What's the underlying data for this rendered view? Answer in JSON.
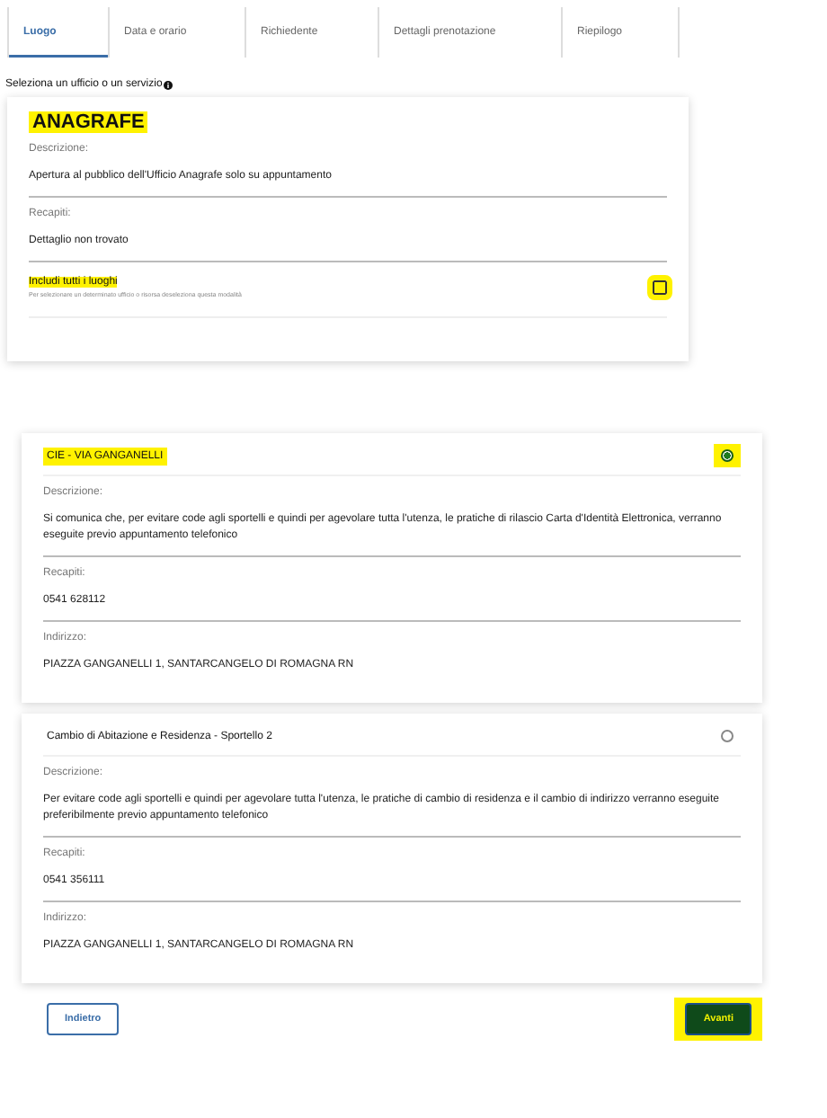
{
  "tabs": [
    {
      "label": "Luogo",
      "selected": true
    },
    {
      "label": "Data e orario",
      "selected": false
    },
    {
      "label": "Richiedente",
      "selected": false
    },
    {
      "label": "Dettagli prenotazione",
      "selected": false
    },
    {
      "label": "Riepilogo",
      "selected": false
    }
  ],
  "prompt": "Seleziona un ufficio o un servizio",
  "service": {
    "title": "ANAGRAFE",
    "title_highlighted": true,
    "fields": [
      {
        "label": "Descrizione:",
        "value": "Apertura al pubblico dell'Ufficio Anagrafe solo su appuntamento"
      },
      {
        "label": "Recapiti:",
        "value": "Dettaglio non trovato"
      }
    ],
    "include_all": {
      "label": "Includi tutti i luoghi",
      "hint": "Per selezionare un determinato ufficio o risorsa deseleziona questa modalità",
      "checked": false,
      "highlighted": true
    }
  },
  "offices": [
    {
      "name": "CIE - VIA GANGANELLI",
      "selected": true,
      "highlighted": true,
      "fields": [
        {
          "label": "Descrizione:",
          "value": "Si comunica che, per evitare code agli sportelli e quindi per agevolare tutta l'utenza, le pratiche di rilascio Carta d'Identità Elettronica, verranno eseguite previo appuntamento telefonico"
        },
        {
          "label": "Recapiti:",
          "value": "0541 628112"
        },
        {
          "label": "Indirizzo:",
          "value": "PIAZZA GANGANELLI 1, SANTARCANGELO DI ROMAGNA RN"
        }
      ]
    },
    {
      "name": "Cambio di Abitazione e Residenza - Sportello 2",
      "selected": false,
      "highlighted": false,
      "fields": [
        {
          "label": "Descrizione:",
          "value": "Per evitare code agli sportelli e quindi per agevolare tutta l'utenza, le pratiche di cambio di residenza e il cambio di indirizzo verranno eseguite preferibilmente previo appuntamento telefonico"
        },
        {
          "label": "Recapiti:",
          "value": "0541 356111"
        },
        {
          "label": "Indirizzo:",
          "value": "PIAZZA GANGANELLI 1, SANTARCANGELO DI ROMAGNA RN"
        }
      ]
    }
  ],
  "buttons": [
    {
      "label": "Indietro",
      "kind": "secondary",
      "highlighted": false
    },
    {
      "label": "Avanti",
      "kind": "primary",
      "highlighted": true
    }
  ]
}
